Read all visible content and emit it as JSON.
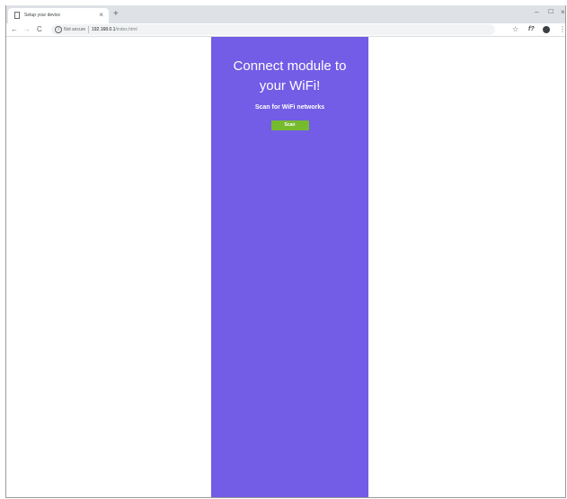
{
  "browser": {
    "tab_title": "Setup your device",
    "tab_close": "×",
    "new_tab": "+",
    "window_controls": {
      "minimize": "–",
      "maximize": "☐",
      "close": "×"
    },
    "nav": {
      "back": "←",
      "forward": "→",
      "reload": "C"
    },
    "address": {
      "security_label": "Not secure",
      "host": "192.168.0.1",
      "path": "/index.html"
    },
    "icons": {
      "star": "☆",
      "extension": "f?",
      "menu": "⋮"
    }
  },
  "page": {
    "title": "Connect module to your WiFi!",
    "subtitle": "Scan for WiFi networks",
    "scan_button_label": "Scan",
    "colors": {
      "panel_background": "#735ce6",
      "scan_button": "#76bb2f",
      "text": "#ffffff"
    }
  }
}
